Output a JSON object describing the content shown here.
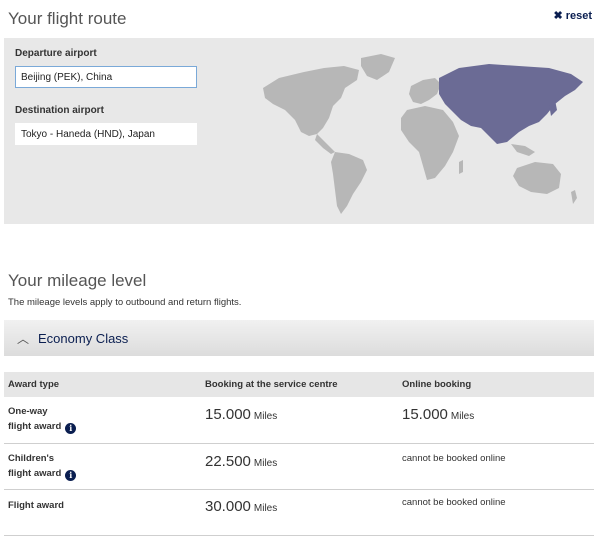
{
  "route": {
    "title": "Your flight route",
    "reset_label": "reset",
    "departure_label": "Departure airport",
    "departure_value": "Beijing (PEK), China",
    "destination_label": "Destination airport",
    "destination_value": "Tokyo - Haneda (HND), Japan",
    "colors": {
      "land": "#b7b7b7",
      "highlight": "#6b6b95"
    }
  },
  "mileage": {
    "title": "Your mileage level",
    "subtitle": "The mileage levels apply to outbound and return flights.",
    "class_label": "Economy Class",
    "headers": [
      "Award type",
      "Booking at the service centre",
      "Online booking"
    ],
    "rows": [
      {
        "award_line1": "One-way",
        "award_line2": "flight award",
        "service": "15.000",
        "service_unit": "Miles",
        "online": "15.000",
        "online_unit": "Miles"
      },
      {
        "award_line1": "Children's",
        "award_line2": "flight award",
        "service": "22.500",
        "service_unit": "Miles",
        "online_text": "cannot be booked online"
      },
      {
        "award_line1": "Flight award",
        "service": "30.000",
        "service_unit": "Miles",
        "online_text": "cannot be booked online"
      }
    ]
  }
}
